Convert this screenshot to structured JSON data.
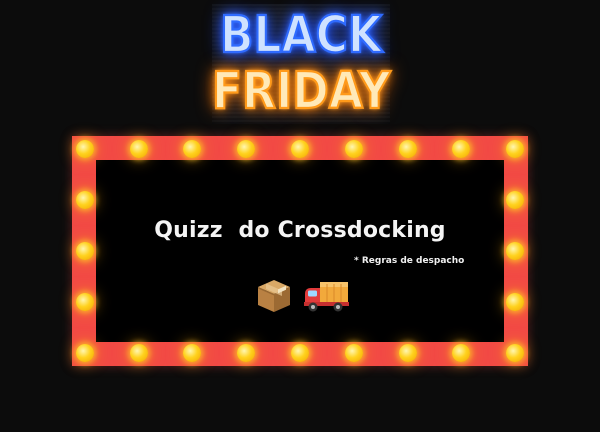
{
  "banner": {
    "line1": "BLACK",
    "line2": "FRIDAY",
    "line1_color": "#2f6bff",
    "line2_color": "#ff9a1a"
  },
  "marquee": {
    "frame_color": "#f24a45",
    "bulb_color": "#ffd21e",
    "title": "Quizz  do Crossdocking",
    "footnote": "* Regras de despacho",
    "icons": [
      "package-icon",
      "delivery-truck-icon"
    ]
  }
}
